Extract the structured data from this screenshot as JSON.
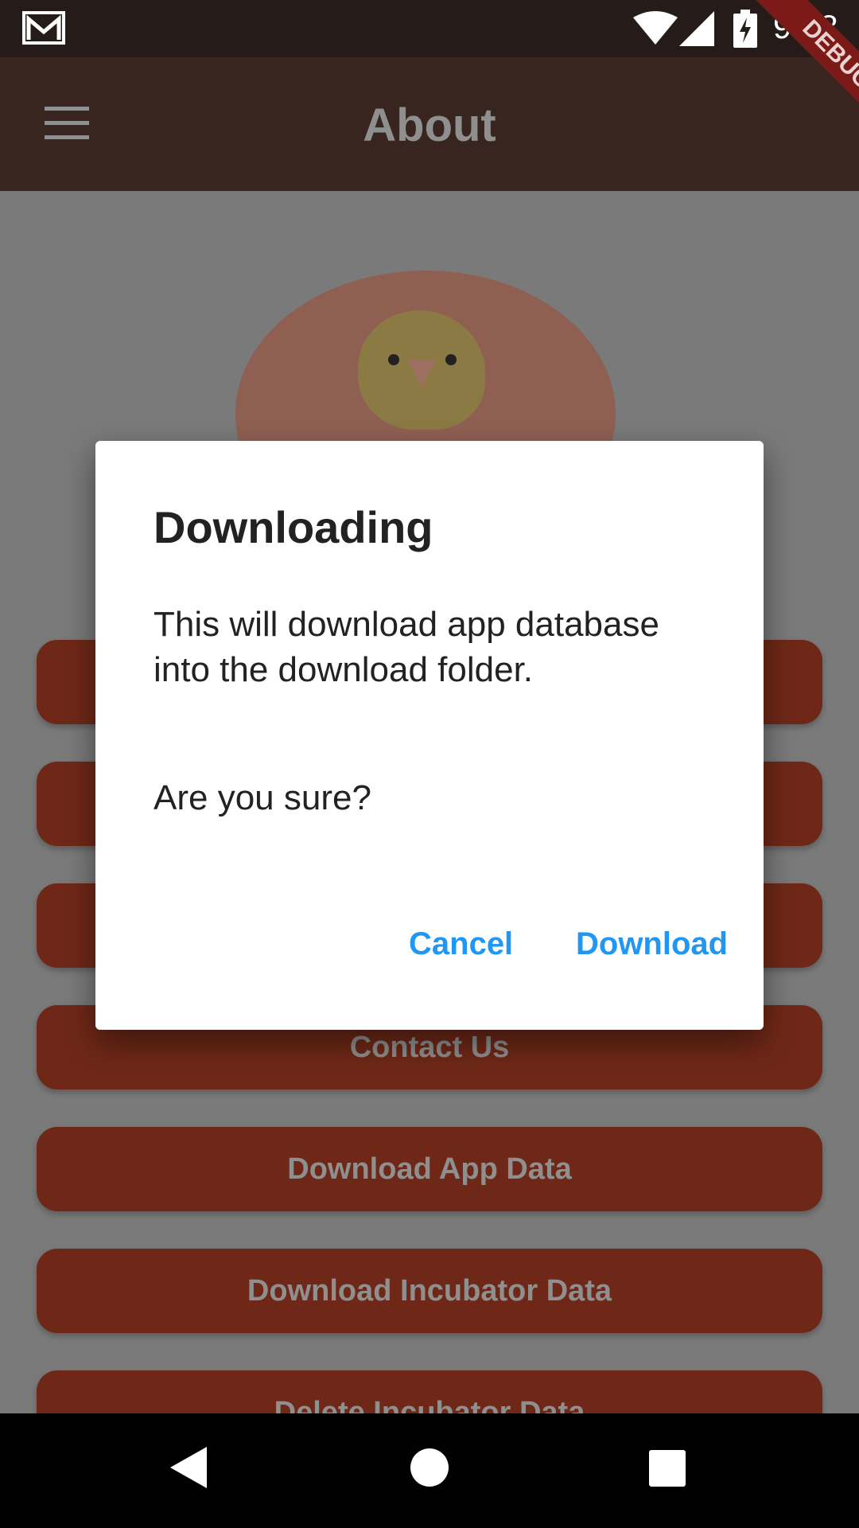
{
  "status_bar": {
    "time": "9:08"
  },
  "debug_banner": "DEBUG",
  "app_bar": {
    "title": "About"
  },
  "buttons": [
    {
      "label": ""
    },
    {
      "label": ""
    },
    {
      "label": ""
    },
    {
      "label": "Contact Us"
    },
    {
      "label": "Download App Data"
    },
    {
      "label": "Download Incubator Data"
    },
    {
      "label": "Delete Incubator Data"
    }
  ],
  "dialog": {
    "title": "Downloading",
    "body": "This will download app database into the download folder.",
    "question": "Are you sure?",
    "cancel_label": "Cancel",
    "confirm_label": "Download"
  },
  "colors": {
    "accent": "#2196f3",
    "app_bar": "#38251f",
    "button": "#6f2817"
  }
}
